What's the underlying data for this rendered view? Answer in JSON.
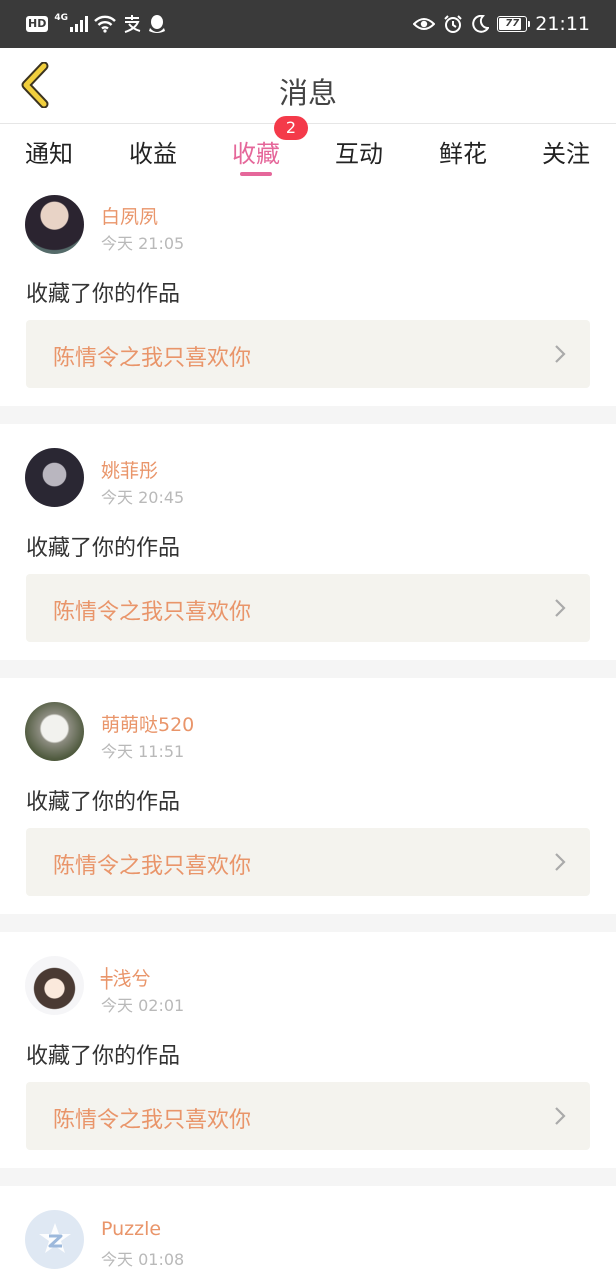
{
  "status_bar": {
    "hd": "HD",
    "network": "4G",
    "battery": "77",
    "time": "21:11",
    "icons": [
      "signal-icon",
      "wifi-icon",
      "alipay-icon",
      "qq-icon",
      "eye-icon",
      "alarm-icon",
      "moon-icon"
    ]
  },
  "header": {
    "title": "消息",
    "back_icon": "chevron-left-icon"
  },
  "tabs": [
    {
      "label": "通知"
    },
    {
      "label": "收益"
    },
    {
      "label": "收藏",
      "active": true,
      "badge": "2"
    },
    {
      "label": "互动"
    },
    {
      "label": "鲜花"
    },
    {
      "label": "关注"
    }
  ],
  "colors": {
    "accent_pink": "#e5679a",
    "name_orange": "#e9956a",
    "badge_red": "#f43a4a",
    "card_bg": "#f4f3ee"
  },
  "messages": [
    {
      "name": "白夙夙",
      "time": "今天 21:05",
      "action": "收藏了你的作品",
      "work": "陈情令之我只喜欢你"
    },
    {
      "name": "姚菲彤",
      "time": "今天 20:45",
      "action": "收藏了你的作品",
      "work": "陈情令之我只喜欢你"
    },
    {
      "name": "萌萌哒520",
      "time": "今天 11:51",
      "action": "收藏了你的作品",
      "work": "陈情令之我只喜欢你"
    },
    {
      "name": "╪浅兮",
      "time": "今天 02:01",
      "action": "收藏了你的作品",
      "work": "陈情令之我只喜欢你"
    },
    {
      "name": "Puzzle",
      "time": "今天 01:08"
    }
  ]
}
